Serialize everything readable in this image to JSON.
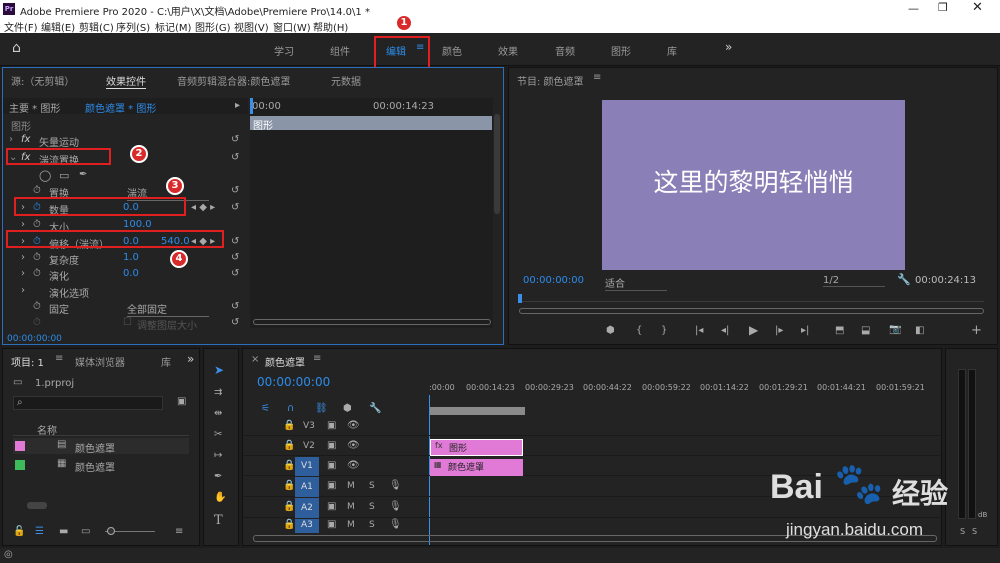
{
  "window": {
    "title": "Adobe Premiere Pro 2020 - C:\\用户\\X\\文档\\Adobe\\Premiere Pro\\14.0\\1 *",
    "app_icon": "Pr"
  },
  "menu": [
    "文件(F)",
    "编辑(E)",
    "剪辑(C)",
    "序列(S)",
    "标记(M)",
    "图形(G)",
    "视图(V)",
    "窗口(W)",
    "帮助(H)"
  ],
  "workspaces": [
    "学习",
    "组件",
    "编辑",
    "颜色",
    "效果",
    "音频",
    "图形",
    "库"
  ],
  "source_panel": {
    "tabs": [
      "源:（无剪辑）",
      "效果控件",
      "音频剪辑混合器:颜色遮罩",
      "元数据"
    ],
    "clip_path": "主要 * 图形",
    "clip_active": "颜色遮罩 * 图形",
    "ruler_start": "00:00",
    "ruler_mid": "00:00:14:23",
    "graphic_label": "图形",
    "section": "图形",
    "effects": [
      "矢量运动",
      "湍流置换"
    ],
    "props": {
      "displace": "置换",
      "displace_val": "湍流",
      "amount": "数量",
      "amount_val": "0.0",
      "size": "大小",
      "size_val": "100.0",
      "offset": "偏移（湍流）",
      "offset_x": "0.0",
      "offset_y": "540.0",
      "complexity": "复杂度",
      "complexity_val": "1.0",
      "evolution": "演化",
      "evolution_val": "0.0",
      "evo_options": "演化选项",
      "pin": "固定",
      "pin_val": "全部固定",
      "resize": "调整图层大小"
    },
    "timecode": "00:00:00:00"
  },
  "program_panel": {
    "title": "节目: 颜色遮罩",
    "overlay_text": "这里的黎明轻悄悄",
    "overlay_bg": "#8a7fb6",
    "timecode": "00:00:00:00",
    "fit": "适合",
    "ratio": "1/2",
    "duration": "00:00:24:13"
  },
  "project_panel": {
    "tabs": [
      "项目: 1",
      "媒体浏览器",
      "库"
    ],
    "file": "1.prproj",
    "col": "名称",
    "items": [
      {
        "name": "颜色遮罩",
        "color": "#e07ad6"
      },
      {
        "name": "颜色遮罩",
        "color": "#3dbb5a"
      }
    ]
  },
  "timeline": {
    "title": "颜色遮罩",
    "timecode": "00:00:00:00",
    "ruler": [
      ":00:00",
      "00:00:14:23",
      "00:00:29:23",
      "00:00:44:22",
      "00:00:59:22",
      "00:01:14:22",
      "00:01:29:21",
      "00:01:44:21",
      "00:01:59:21"
    ],
    "tracks": [
      "V3",
      "V2",
      "V1",
      "A1",
      "A2",
      "A3"
    ],
    "clips": [
      {
        "label": "图形",
        "track": "V2"
      },
      {
        "label": "颜色遮罩",
        "track": "V1"
      }
    ],
    "clip_color": "#e07ad6"
  },
  "annotations": [
    "1",
    "2",
    "3",
    "4"
  ],
  "watermark": {
    "brand": "Bai",
    "brand2": "经验",
    "url": "jingyan.baidu.com"
  },
  "audio_meter": {
    "db": "dB",
    "labels": [
      "-",
      "-",
      "-",
      "-",
      "-",
      "-"
    ]
  }
}
